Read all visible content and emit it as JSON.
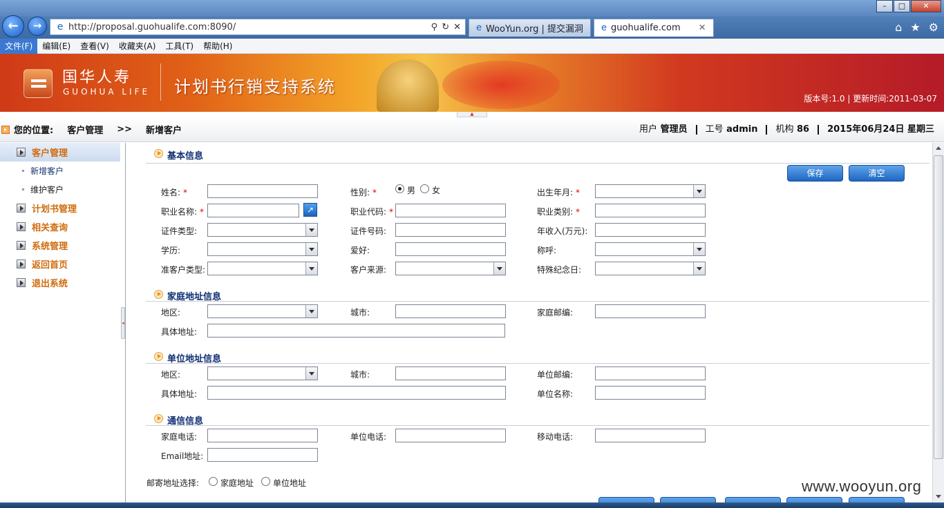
{
  "browser": {
    "url": "http://proposal.guohualife.com:8090/",
    "tabs": [
      {
        "label": "WooYun.org | 提交漏洞",
        "active": false
      },
      {
        "label": "guohualife.com",
        "active": true
      }
    ],
    "menu": [
      "文件(F)",
      "编辑(E)",
      "查看(V)",
      "收藏夹(A)",
      "工具(T)",
      "帮助(H)"
    ]
  },
  "banner": {
    "company_cn": "国华人寿",
    "company_en": "GUOHUA LIFE",
    "system_title": "计划书行销支持系统",
    "version": "版本号:1.0 | 更新时间:2011-03-07"
  },
  "location": {
    "label": "您的位置:",
    "crumb1": "客户管理",
    "sep": ">>",
    "crumb2": "新增客户",
    "user_k": "用户",
    "user_v": "管理员",
    "id_k": "工号",
    "id_v": "admin",
    "org_k": "机构",
    "org_v": "86",
    "date": "2015年06月24日 星期三"
  },
  "sidebar": {
    "customer": "客户管理",
    "sub_new": "新增客户",
    "sub_maintain": "维护客户",
    "plan": "计划书管理",
    "query": "相关查询",
    "system": "系统管理",
    "home": "返回首页",
    "logout": "退出系统"
  },
  "form": {
    "sections": {
      "basic": "基本信息",
      "home_addr": "家庭地址信息",
      "work_addr": "单位地址信息",
      "contact": "通信信息"
    },
    "buttons": {
      "save": "保存",
      "clear": "清空"
    },
    "labels": {
      "name": "姓名:",
      "gender": "性别:",
      "male": "男",
      "female": "女",
      "birth": "出生年月:",
      "job_name": "职业名称:",
      "job_code": "职业代码:",
      "job_type": "职业类别:",
      "id_type": "证件类型:",
      "id_no": "证件号码:",
      "income": "年收入(万元):",
      "edu": "学历:",
      "hobby": "爱好:",
      "title": "称呼:",
      "prospect": "准客户类型:",
      "source": "客户来源:",
      "anniv": "特殊纪念日:",
      "region": "地区:",
      "city": "城市:",
      "home_zip": "家庭邮编:",
      "addr": "具体地址:",
      "work_zip": "单位邮编:",
      "work_name": "单位名称:",
      "home_phone": "家庭电话:",
      "work_phone": "单位电话:",
      "mobile": "移动电话:",
      "email": "Email地址:",
      "mail_choice": "邮寄地址选择:",
      "mail_home": "家庭地址",
      "mail_work": "单位地址",
      "required_mark": "*"
    }
  },
  "watermark": "www.wooyun.org"
}
